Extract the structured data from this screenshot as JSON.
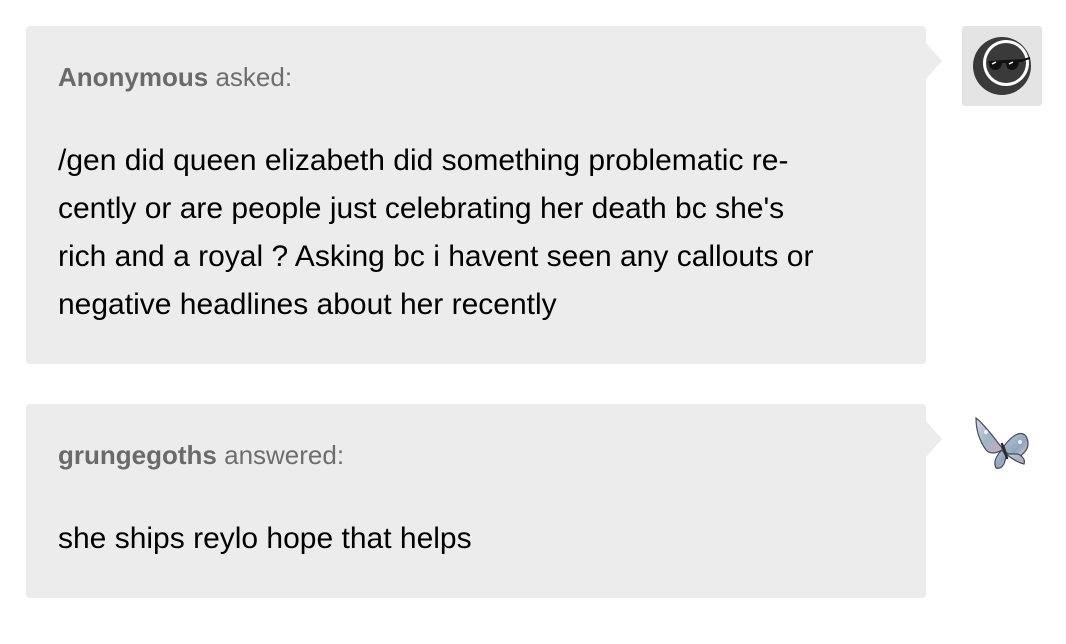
{
  "ask": {
    "asker_name": "Anonymous",
    "asker_verb": "asked:",
    "question_lines": [
      "/gen did queen elizabeth did something problematic re-",
      "cently or are people just celebrating her death bc she's",
      "rich and a royal ? Asking bc i havent seen any callouts or",
      "negative headlines about her recently"
    ],
    "avatar_icon": "anonymous-sunglasses-icon"
  },
  "answer": {
    "answerer_name": "grungegoths",
    "answerer_verb": "answered:",
    "answer_text": "she ships reylo hope that helps",
    "avatar_icon": "butterfly-icon"
  },
  "colors": {
    "bubble_bg": "#ececec",
    "header_text": "#6e6e6e",
    "body_text": "#000000"
  }
}
